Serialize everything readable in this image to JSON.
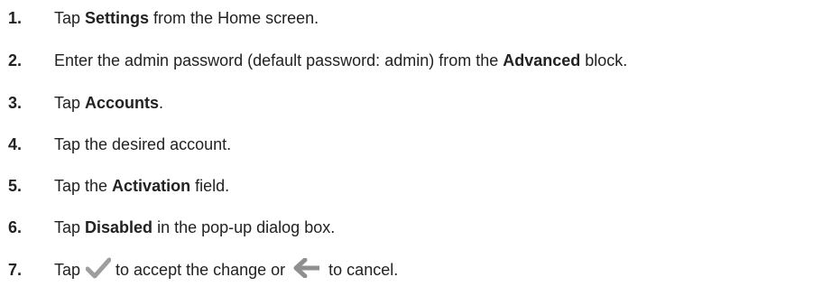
{
  "steps": [
    {
      "num": "1.",
      "pre": "Tap ",
      "bold": "Settings",
      "post": " from the Home screen."
    },
    {
      "num": "2.",
      "pre": "Enter the admin password (default password: admin) from the ",
      "bold": "Advanced",
      "post": " block."
    },
    {
      "num": "3.",
      "pre": "Tap ",
      "bold": "Accounts",
      "post": "."
    },
    {
      "num": "4.",
      "text": "Tap the desired account."
    },
    {
      "num": "5.",
      "pre": "Tap the ",
      "bold": "Activation",
      "post": " field."
    },
    {
      "num": "6.",
      "pre": "Tap ",
      "bold": "Disabled",
      "post": " in the pop-up dialog box."
    },
    {
      "num": "7.",
      "pre": "Tap",
      "mid": "to accept the change or",
      "post": "to cancel.",
      "icons": [
        "checkmark-icon",
        "back-arrow-icon"
      ]
    }
  ],
  "colors": {
    "text": "#222222",
    "icon": "#9e9e9e"
  }
}
